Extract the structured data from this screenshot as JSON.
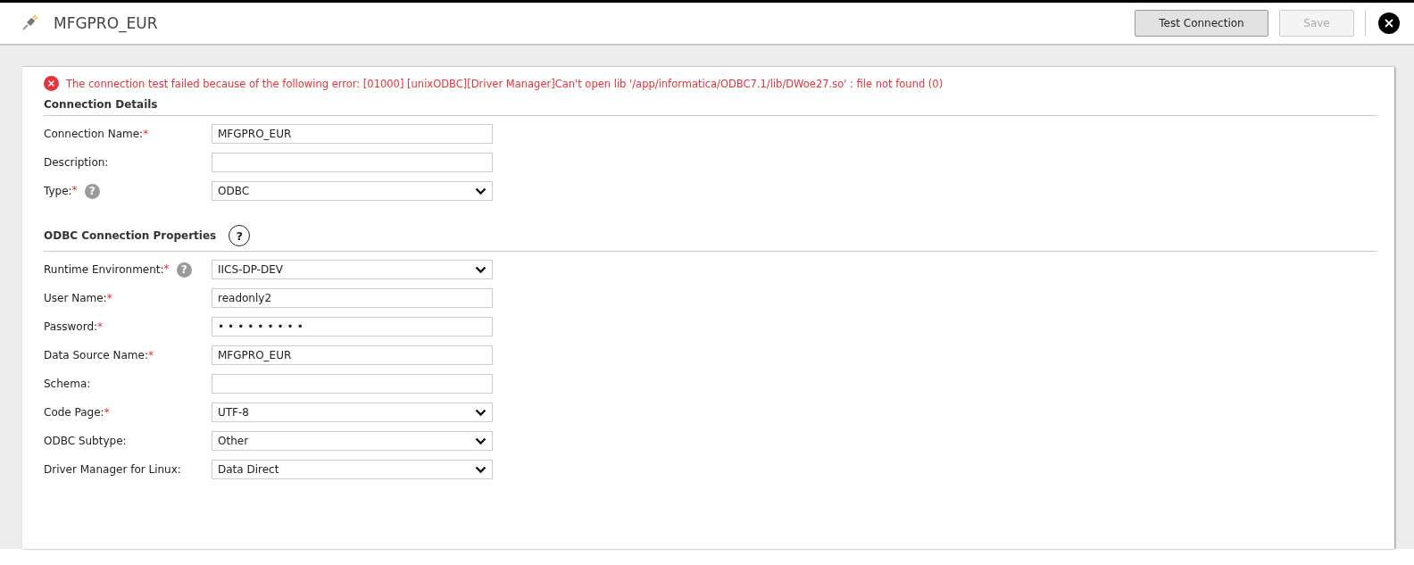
{
  "header": {
    "title": "MFGPRO_EUR",
    "buttons": [
      {
        "label": "Test Connection",
        "disabled": false
      },
      {
        "label": "Save",
        "disabled": true
      }
    ]
  },
  "error": "The connection test failed because of the following error: [01000] [unixODBC][Driver Manager]Can't open lib '/app/informatica/ODBC7.1/lib/DWoe27.so' : file not found (0)",
  "sections": [
    {
      "title": "Connection Details",
      "fields": [
        {
          "label": "Connection Name:",
          "required_mark": "*",
          "kind": "text",
          "value": "MFGPRO_EUR"
        },
        {
          "label": "Description:",
          "kind": "text"
        },
        {
          "label": "Type:",
          "required_mark": "*",
          "help": "?",
          "kind": "select",
          "value": "ODBC"
        }
      ]
    },
    {
      "title": "ODBC Connection Properties",
      "help": "?",
      "fields": [
        {
          "label": "Runtime Environment:",
          "required_mark": "*",
          "help": "?",
          "kind": "select",
          "value": "IICS-DP-DEV"
        },
        {
          "label": "User Name:",
          "required_mark": "*",
          "kind": "text",
          "value": "readonly2"
        },
        {
          "label": "Password:",
          "required_mark": "*",
          "kind": "password",
          "value": "•••••••••"
        },
        {
          "label": "Data Source Name:",
          "required_mark": "*",
          "kind": "text",
          "value": "MFGPRO_EUR"
        },
        {
          "label": "Schema:",
          "kind": "text"
        },
        {
          "label": "Code Page:",
          "required_mark": "*",
          "kind": "select",
          "value": "UTF-8"
        },
        {
          "label": "ODBC Subtype:",
          "kind": "select",
          "value": "Other"
        },
        {
          "label": "Driver Manager for Linux:",
          "kind": "select",
          "value": "Data Direct"
        }
      ]
    }
  ]
}
